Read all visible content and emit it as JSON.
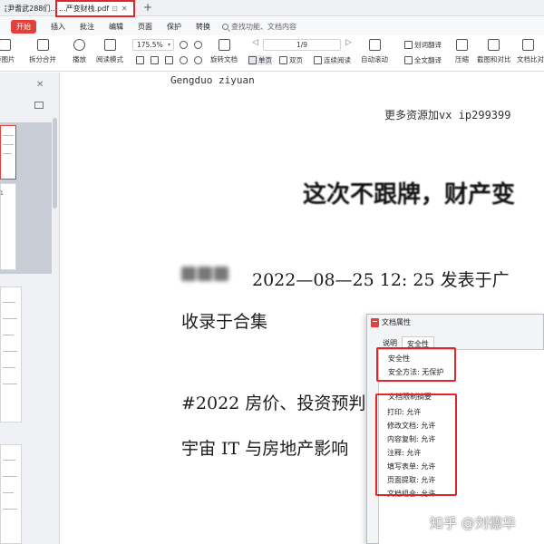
{
  "tabs": [
    {
      "label": "[尹耆武288们..."
    },
    {
      "label": "...严变财栈.pdf",
      "pin": "⊡",
      "close": "✕"
    }
  ],
  "tab_add": "+",
  "menu": {
    "start": "开始",
    "items": [
      "插入",
      "批注",
      "编辑",
      "页面",
      "保护",
      "转换"
    ],
    "search_placeholder": "查找功能、文档内容"
  },
  "ribbon": {
    "pdf_to_image": "转图片",
    "split_merge": "拆分合并",
    "play": "播放",
    "read_mode": "阅读模式",
    "zoom": "175.5%",
    "rotate": "旋转文档",
    "single_page": "单页",
    "double_page": "双页",
    "continuous": "连续阅读",
    "auto_scroll": "自动滚动",
    "page": "1/9",
    "translate": "划词翻译",
    "full_translate": "全文翻译",
    "compress": "压缩",
    "screenshot_compare": "截图和对比",
    "doc_compare": "文档比对"
  },
  "thumbnail_label": "1",
  "document": {
    "header": "Gengduo ziyuan",
    "wechat": "更多资源加vx  ip299399",
    "title": "这次不跟牌，财产变",
    "date_line": "2022—08—25 12: 25 发表于广",
    "collect": "收录于合集",
    "tag_line": "#2022 房价、投资预判",
    "meta_line": "宇宙 IT 与房地产影响"
  },
  "dialog": {
    "title": "文档属性",
    "tabs": [
      "说明",
      "安全性"
    ],
    "active_tab": 1,
    "security_label": "安全性",
    "security_method": "安全方法: 无保护",
    "summary_label": "文档限制摘要",
    "permissions": [
      "打印: 允许",
      "修改文档: 允许",
      "内容复制: 允许",
      "注释: 允许",
      "填写表单: 允许",
      "页面提取: 允许",
      "文档组合: 允许"
    ]
  },
  "watermark": "知乎 @刘德华",
  "colors": {
    "accent": "#e0413a",
    "highlight": "#e0252b"
  }
}
